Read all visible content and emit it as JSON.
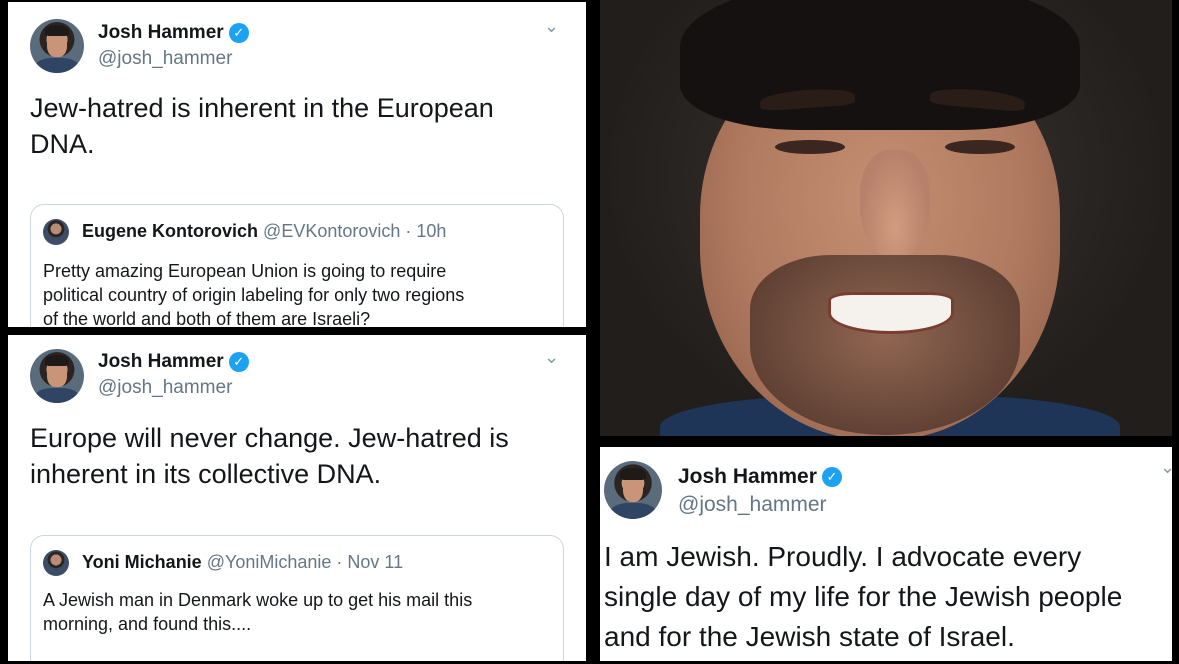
{
  "tweet1": {
    "author_name": "Josh Hammer",
    "author_handle": "@josh_hammer",
    "text_lines": [
      "Jew-hatred is inherent in the European",
      "DNA."
    ],
    "quote": {
      "name": "Eugene Kontorovich",
      "handle": "@EVKontorovich",
      "time": "· 10h",
      "text_lines": [
        "Pretty amazing European Union is going to require",
        "political  country of origin labeling for only two regions",
        "of the world and both of them are Israeli?"
      ]
    }
  },
  "tweet2": {
    "author_name": "Josh Hammer",
    "author_handle": "@josh_hammer",
    "text_lines": [
      "Europe will never change. Jew-hatred is",
      "inherent in its collective DNA."
    ],
    "quote": {
      "name": "Yoni Michanie",
      "handle": "@YoniMichanie",
      "time": "· Nov 11",
      "text_lines": [
        "A Jewish man in Denmark woke up to get his mail this",
        "morning, and found this...."
      ]
    }
  },
  "tweet3": {
    "author_name": "Josh Hammer",
    "author_handle": "@josh_hammer",
    "text_lines": [
      "I am Jewish. Proudly. I advocate every",
      "single day of my life for the Jewish people",
      "and for the Jewish state of Israel."
    ]
  },
  "icons": {
    "verified": "✓",
    "caret": "⌄"
  },
  "colors": {
    "verified_blue": "#1da1f2",
    "handle_gray": "#657786"
  }
}
